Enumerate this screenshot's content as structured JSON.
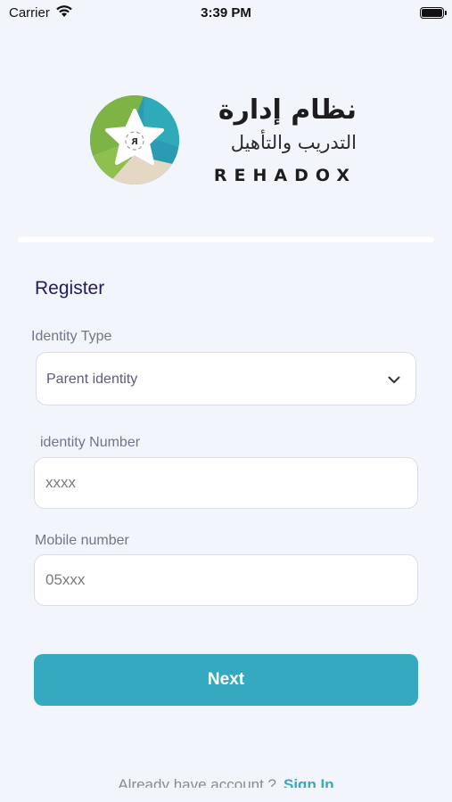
{
  "status_bar": {
    "carrier": "Carrier",
    "time": "3:39 PM"
  },
  "logo": {
    "arabic_line1": "نظام إدارة",
    "arabic_line2": "التدريب والتأهيل",
    "english": "REHADOX",
    "emblem_letter": "R",
    "colors": {
      "green": "#7db445",
      "teal": "#2a9bb2",
      "sand": "#e4d8c4"
    }
  },
  "form": {
    "title": "Register",
    "identity_type": {
      "label": "Identity Type",
      "selected": "Parent identity"
    },
    "identity_number": {
      "label": "identity Number",
      "placeholder": "xxxx"
    },
    "mobile_number": {
      "label": "Mobile number",
      "placeholder": "05xxx"
    },
    "next_label": "Next"
  },
  "footer": {
    "prompt": "Already have account ?",
    "signin_label": "Sign In"
  },
  "colors": {
    "accent": "#35a9bf",
    "title": "#1c1c5e",
    "background": "#f2f5fb"
  }
}
